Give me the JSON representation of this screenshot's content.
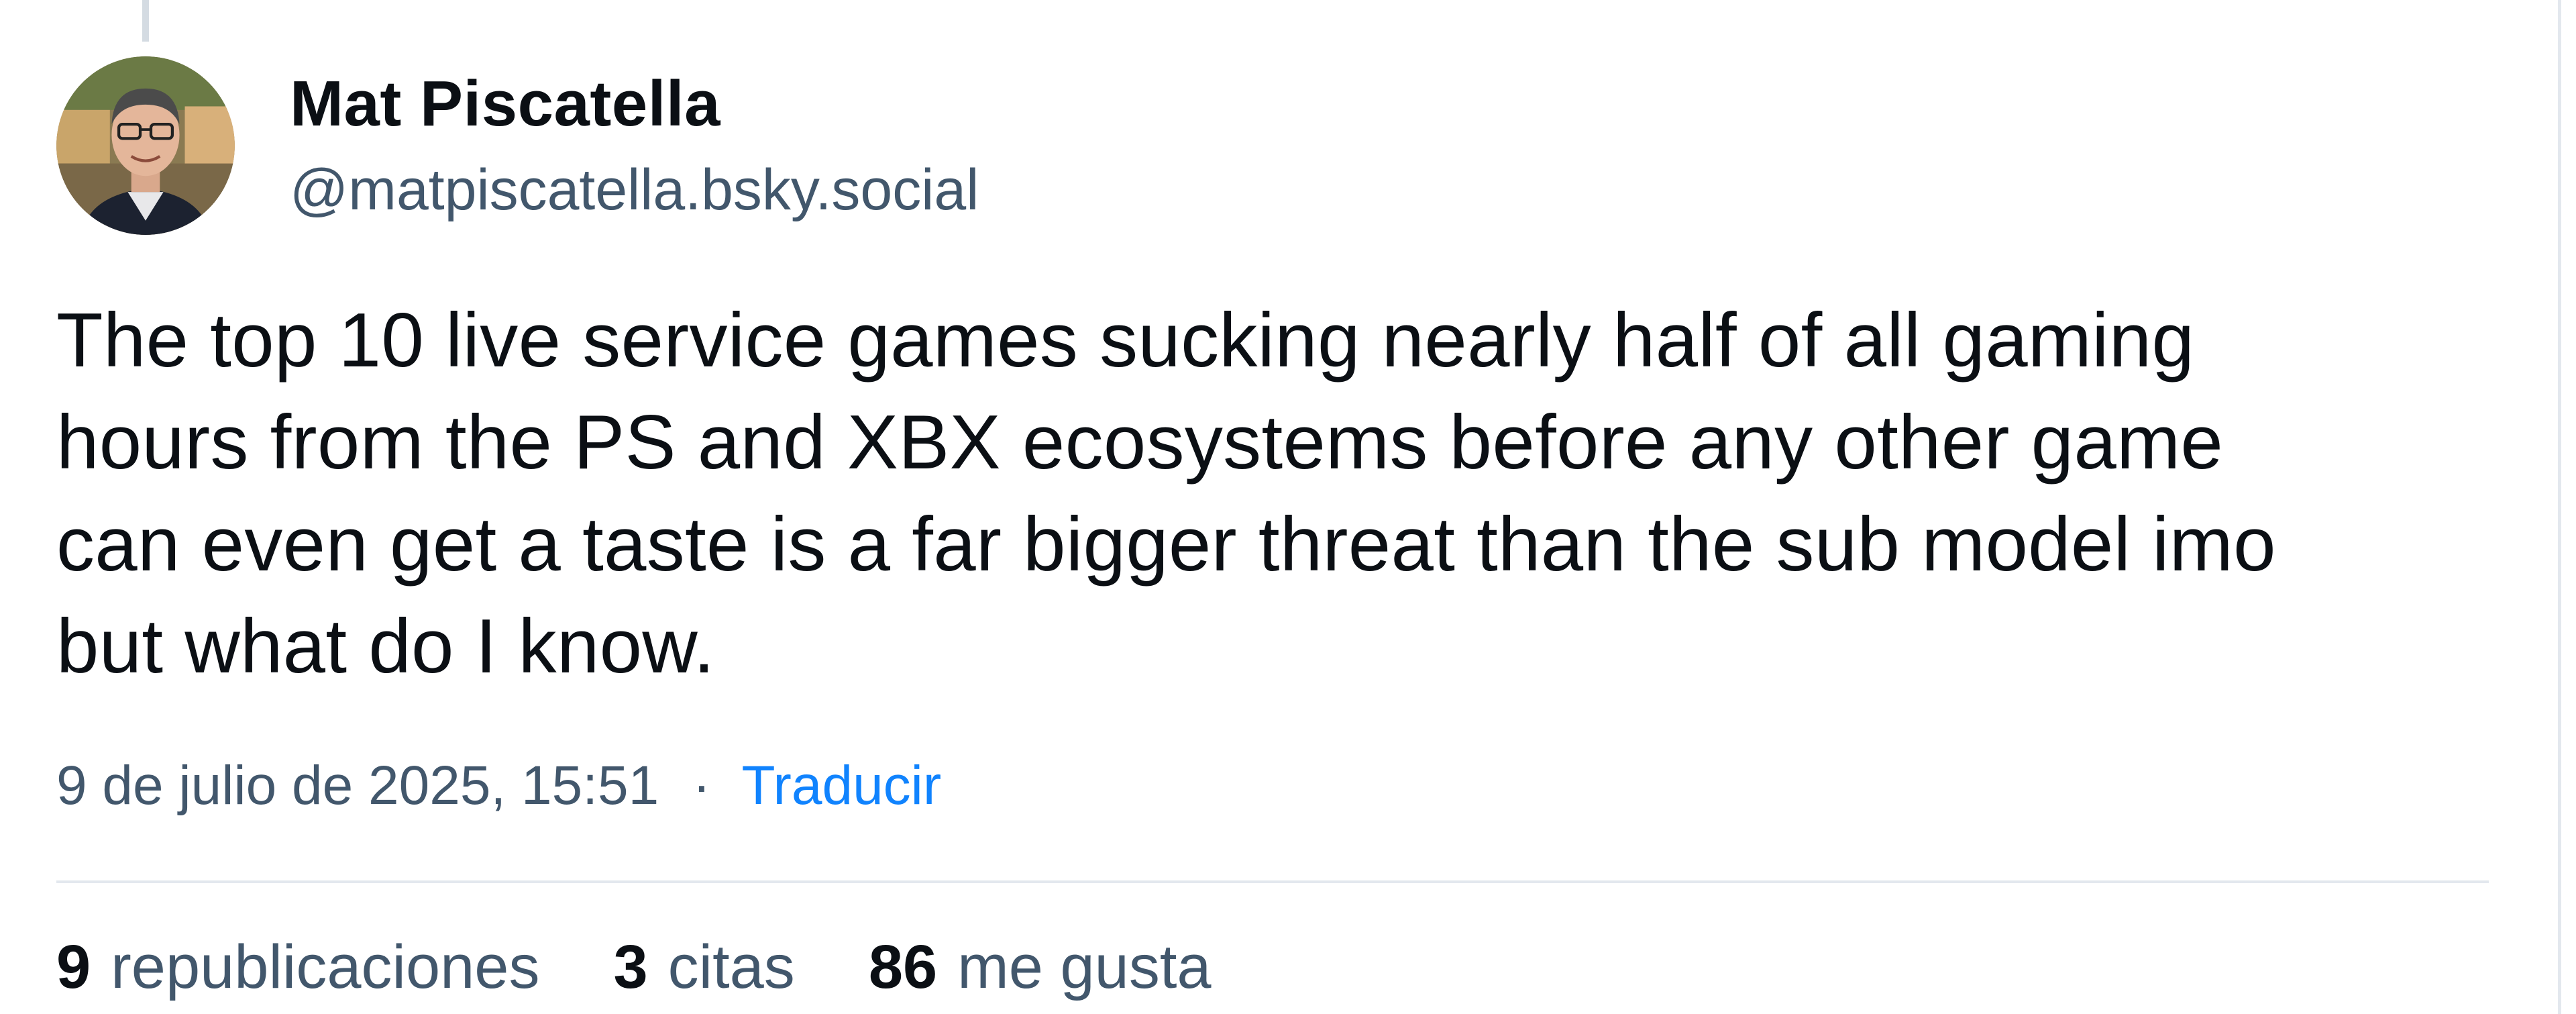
{
  "post": {
    "author": {
      "display_name": "Mat Piscatella",
      "handle": "@matpiscatella.bsky.social"
    },
    "text": "The top 10 live service games sucking nearly half of all gaming\nhours from the PS and XBX ecosystems before any other game\ncan even get a taste is a far bigger threat than the sub model imo\nbut what do I know.",
    "timestamp": "9 de julio de 2025, 15:51",
    "separator": "·",
    "translate_label": "Traducir",
    "stats": {
      "reposts": {
        "count": "9",
        "label": "republicaciones"
      },
      "quotes": {
        "count": "3",
        "label": "citas"
      },
      "likes": {
        "count": "86",
        "label": "me gusta"
      }
    }
  },
  "colors": {
    "text_primary": "#0b0f14",
    "text_secondary": "#42576c",
    "link": "#1083fe",
    "divider": "#e3e8ee"
  }
}
